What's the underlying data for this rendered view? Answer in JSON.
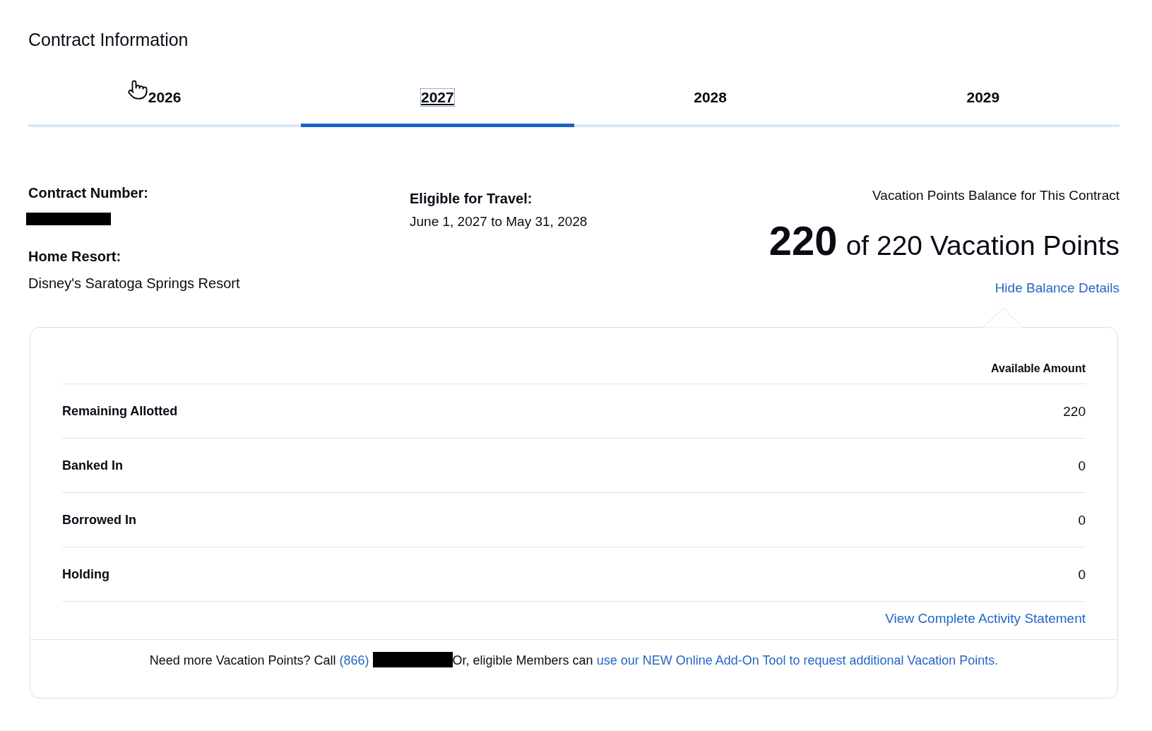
{
  "page": {
    "title": "Contract Information"
  },
  "tabs": [
    {
      "label": "2026",
      "selected": false
    },
    {
      "label": "2027",
      "selected": true
    },
    {
      "label": "2028",
      "selected": false
    },
    {
      "label": "2029",
      "selected": false
    }
  ],
  "contract": {
    "number_label": "Contract Number:",
    "home_resort_label": "Home Resort:",
    "home_resort": "Disney's Saratoga Springs Resort",
    "eligible_label": "Eligible for Travel:",
    "eligible_dates": "June 1, 2027 to May 31, 2028"
  },
  "balance": {
    "heading": "Vacation Points Balance for This Contract",
    "available": "220",
    "total_text": "of 220 Vacation Points",
    "toggle_link": "Hide Balance Details"
  },
  "details": {
    "column_header": "Available Amount",
    "rows": [
      {
        "label": "Remaining Allotted",
        "amount": "220"
      },
      {
        "label": "Banked In",
        "amount": "0"
      },
      {
        "label": "Borrowed In",
        "amount": "0"
      },
      {
        "label": "Holding",
        "amount": "0"
      }
    ],
    "statement_link": "View Complete Activity Statement"
  },
  "footer": {
    "prefix": "Need more Vacation Points? Call",
    "phone_link": "(866)",
    "middle": "Or, eligible Members can",
    "tool_link": "use our NEW Online Add-On Tool to request additional Vacation Points."
  }
}
